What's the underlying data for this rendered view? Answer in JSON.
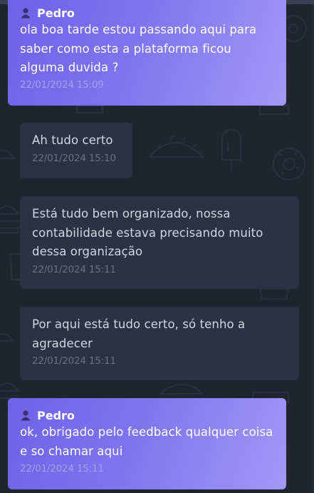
{
  "messages": [
    {
      "direction": "sent",
      "sender": "Pedro",
      "text": "ola boa tarde estou passando aqui para saber como esta a plataforma ficou alguma duvida ?",
      "time": "22/01/2024 15:09"
    },
    {
      "direction": "received",
      "text": "Ah tudo certo",
      "time": "22/01/2024 15:10"
    },
    {
      "direction": "received",
      "text": "Está tudo bem organizado, nossa contabilidade estava precisando muito dessa organização",
      "time": "22/01/2024 15:11"
    },
    {
      "direction": "received",
      "text": "Por aqui está tudo certo, só tenho a agradecer",
      "time": "22/01/2024 15:11"
    },
    {
      "direction": "sent",
      "sender": "Pedro",
      "text": "ok, obrigado pelo feedback qualquer coisa e so chamar aqui",
      "time": "22/01/2024 15:11"
    }
  ],
  "icons": {
    "sender_avatar": "user-icon",
    "background_pattern": [
      "burger-icon",
      "taco-icon",
      "popsicle-icon",
      "donut-icon",
      "cup-icon"
    ]
  },
  "colors": {
    "background": "#20242f",
    "sent_bubble_start": "#7061e6",
    "sent_bubble_end": "#a497f5",
    "received_bubble": "#2c3244",
    "received_text": "#d3d6de",
    "timestamp_received": "#697087",
    "timestamp_sent": "#a7a0e8"
  }
}
